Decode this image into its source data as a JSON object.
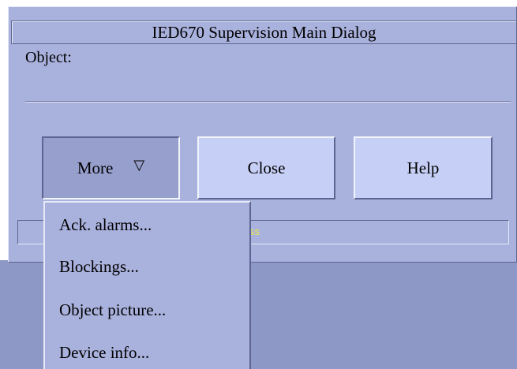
{
  "dialog": {
    "title": "IED670 Supervision Main Dialog",
    "object_label": "Object:",
    "status_text": "ss"
  },
  "buttons": {
    "more_label": "More",
    "more_icon": "▽",
    "close_label": "Close",
    "help_label": "Help"
  },
  "menu": {
    "items": [
      {
        "label": "Ack. alarms..."
      },
      {
        "label": "Blockings..."
      },
      {
        "label": "Object picture..."
      },
      {
        "label": "Device info..."
      }
    ]
  },
  "colors": {
    "dialog_bg": "#a9b1dd",
    "button_bg": "#c6cff5",
    "pressed_button_bg": "#979fcc",
    "status_text": "#f0e84a"
  }
}
